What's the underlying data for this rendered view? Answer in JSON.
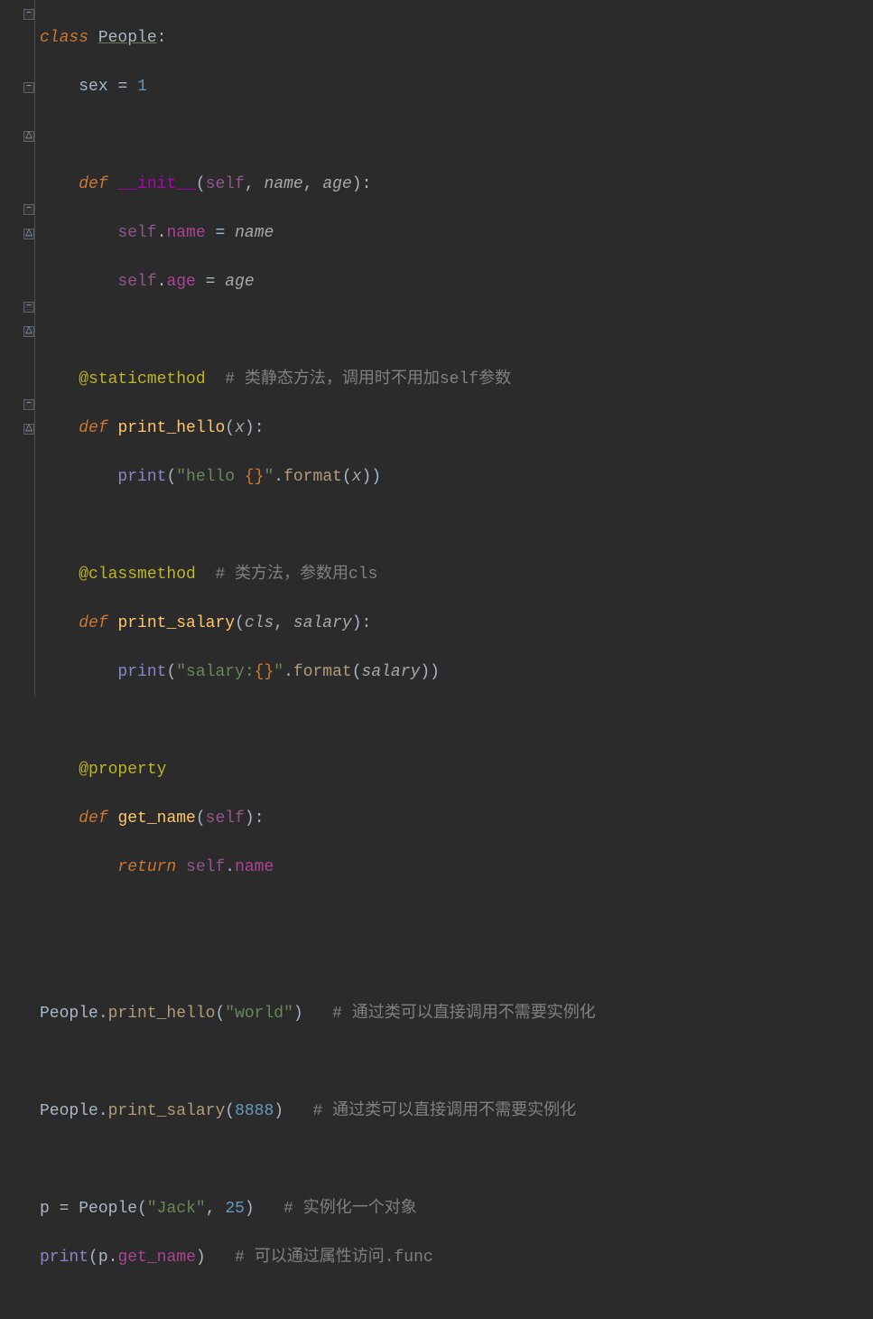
{
  "tokens": {
    "class": "class",
    "People": "People",
    "colon": ":",
    "sex": "sex",
    "eq": "=",
    "one": "1",
    "def": "def",
    "dunder_init": "__init__",
    "lparen": "(",
    "rparen": ")",
    "self": "self",
    "comma": ",",
    "name_p": "name",
    "age_p": "age",
    "dot": ".",
    "name_attr": "name",
    "age_attr": "age",
    "staticmethod": "@staticmethod",
    "cmt_static": "# 类静态方法，调用时不用加self参数",
    "print_hello": "print_hello",
    "x": "x",
    "print": "print",
    "hello_str1": "\"hello ",
    "brace": "{}",
    "hello_str2": "\"",
    "format": "format",
    "classmethod": "@classmethod",
    "cmt_cls": "# 类方法，参数用cls",
    "print_salary": "print_salary",
    "cls": "cls",
    "salary": "salary",
    "salary_str1": "\"salary:",
    "salary_str2": "\"",
    "property": "@property",
    "get_name": "get_name",
    "return": "return",
    "world": "\"world\"",
    "cmt_call1": "# 通过类可以直接调用不需要实例化",
    "num8888": "8888",
    "cmt_call2": "# 通过类可以直接调用不需要实例化",
    "p": "p",
    "jack": "\"Jack\"",
    "twentyfive": "25",
    "cmt_inst": "# 实例化一个对象",
    "cmt_prop": "# 可以通过属性访问.func"
  }
}
